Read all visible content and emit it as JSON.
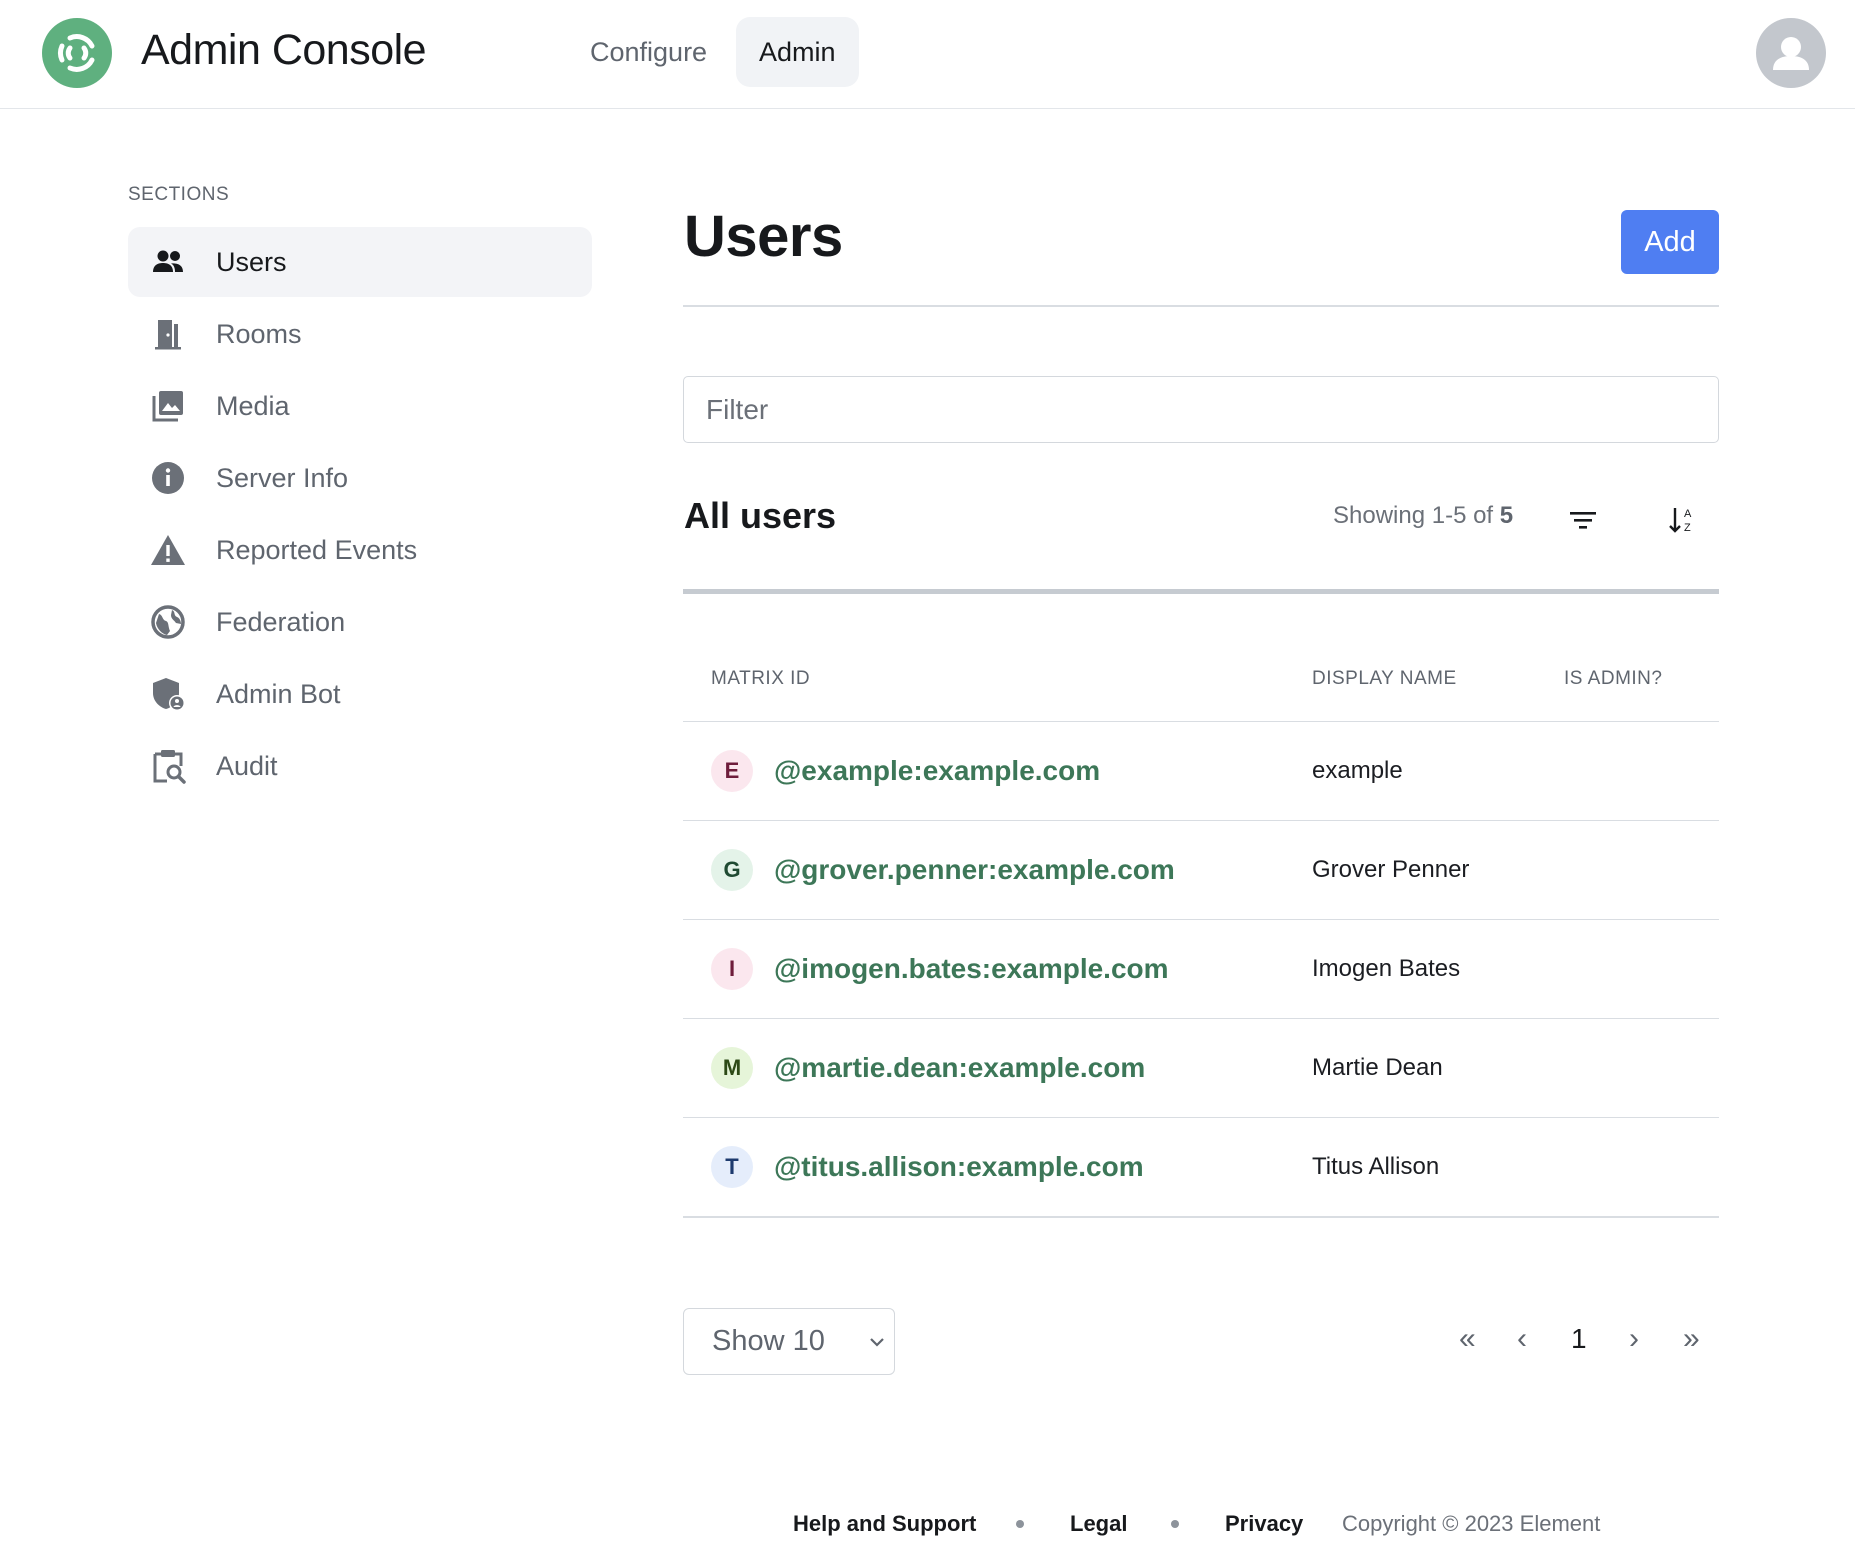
{
  "app": {
    "title": "Admin Console"
  },
  "nav": {
    "tabs": [
      {
        "label": "Configure"
      },
      {
        "label": "Admin"
      }
    ]
  },
  "sidebar": {
    "heading": "SECTIONS",
    "items": [
      {
        "label": "Users",
        "icon": "users-icon"
      },
      {
        "label": "Rooms",
        "icon": "door-icon"
      },
      {
        "label": "Media",
        "icon": "image-icon"
      },
      {
        "label": "Server Info",
        "icon": "info-icon"
      },
      {
        "label": "Reported Events",
        "icon": "warning-icon"
      },
      {
        "label": "Federation",
        "icon": "globe-icon"
      },
      {
        "label": "Admin Bot",
        "icon": "shield-user-icon"
      },
      {
        "label": "Audit",
        "icon": "clipboard-search-icon"
      }
    ]
  },
  "main": {
    "title": "Users",
    "add_label": "Add",
    "filter_placeholder": "Filter",
    "list_title": "All users",
    "showing_prefix": "Showing 1-5 of",
    "showing_total": "5",
    "columns": {
      "matrix_id": "MATRIX ID",
      "display_name": "DISPLAY NAME",
      "is_admin": "IS ADMIN?"
    },
    "users": [
      {
        "initial": "E",
        "matrix_id": "@example:example.com",
        "display_name": "example",
        "avatar_bg": "#fbe7ee",
        "avatar_fg": "#6e1d3b"
      },
      {
        "initial": "G",
        "matrix_id": "@grover.penner:example.com",
        "display_name": "Grover Penner",
        "avatar_bg": "#e4f3e9",
        "avatar_fg": "#1f4a32"
      },
      {
        "initial": "I",
        "matrix_id": "@imogen.bates:example.com",
        "display_name": "Imogen Bates",
        "avatar_bg": "#fbe7ee",
        "avatar_fg": "#6e1d3b"
      },
      {
        "initial": "M",
        "matrix_id": "@martie.dean:example.com",
        "display_name": "Martie Dean",
        "avatar_bg": "#e6f5d9",
        "avatar_fg": "#2d4a16"
      },
      {
        "initial": "T",
        "matrix_id": "@titus.allison:example.com",
        "display_name": "Titus Allison",
        "avatar_bg": "#e5edfb",
        "avatar_fg": "#1d3a6e"
      }
    ],
    "page_size": "Show 10",
    "pagination": {
      "first": "«",
      "prev": "‹",
      "current": "1",
      "next": "›",
      "last": "»"
    }
  },
  "footer": {
    "links": [
      "Help and Support",
      "Legal",
      "Privacy"
    ],
    "copyright": "Copyright © 2023 Element"
  },
  "colors": {
    "accent": "#4f7ef2",
    "brand": "#5fb07f",
    "link": "#3d7758"
  }
}
